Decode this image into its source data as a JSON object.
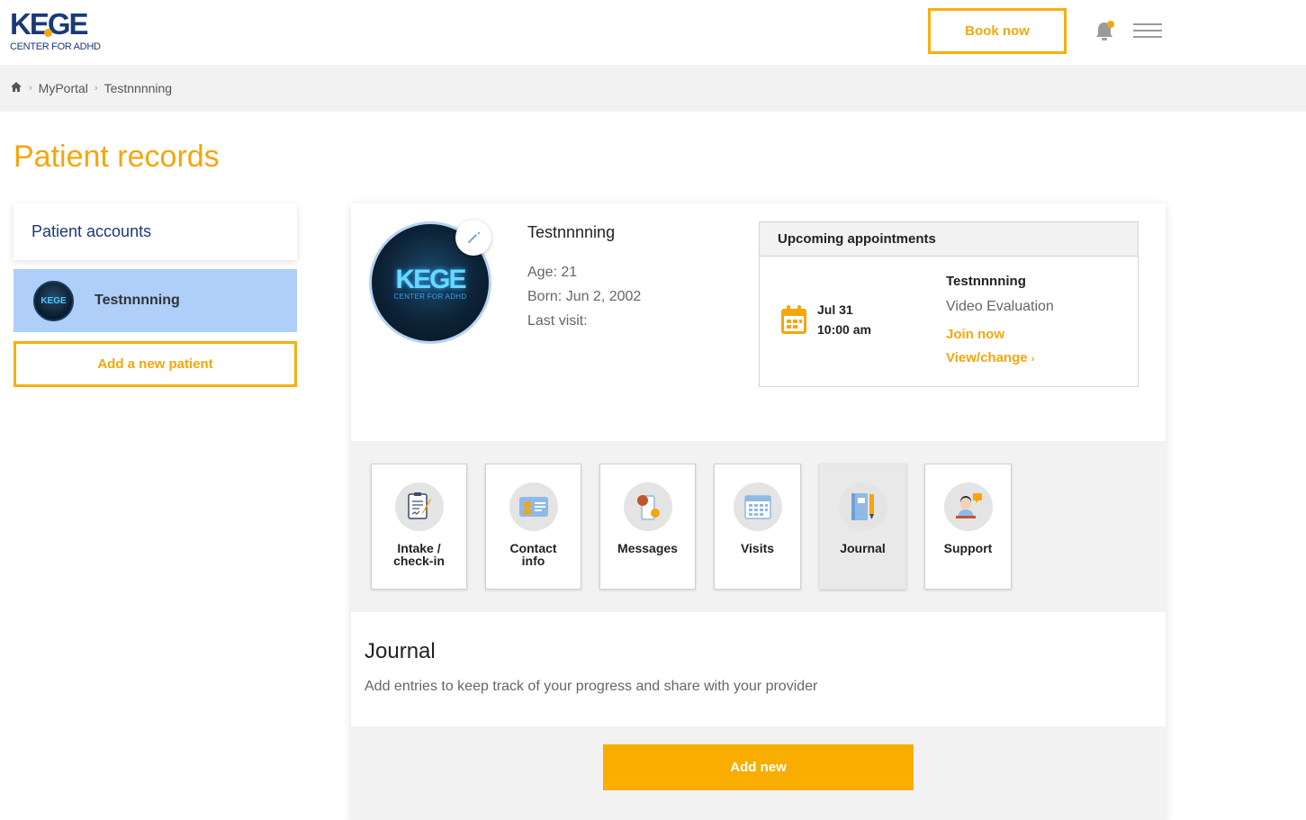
{
  "brand": {
    "logo_text": "KEGE",
    "logo_sub": "CENTER FOR ADHD",
    "accent": "#f5a60b",
    "navy": "#1a3a78"
  },
  "header": {
    "book_label": "Book now",
    "bell_icon": "bell-icon",
    "menu_icon": "hamburger-icon"
  },
  "breadcrumb": {
    "home_icon": "home-icon",
    "items": [
      "MyPortal",
      "Testnnnning"
    ]
  },
  "page": {
    "title": "Patient records"
  },
  "sidebar": {
    "heading": "Patient accounts",
    "patients": [
      {
        "name": "Testnnnning",
        "avatar_text": "KEGE"
      }
    ],
    "add_label": "Add a new patient"
  },
  "patient": {
    "avatar_text": "KEGE",
    "avatar_sub": "CENTER FOR ADHD",
    "name": "Testnnnning",
    "age": "Age: 21",
    "born": "Born: Jun 2, 2002",
    "last_visit": "Last visit:"
  },
  "appointments": {
    "heading": "Upcoming appointments",
    "items": [
      {
        "date": "Jul 31",
        "time": "10:00 am",
        "name": "Testnnnning",
        "type": "Video Evaluation",
        "join_label": "Join now",
        "view_label": "View/change",
        "view_chevron": "›"
      }
    ]
  },
  "tiles": [
    {
      "label": "Intake /\ncheck-in",
      "icon": "clipboard-pen-icon",
      "active": false
    },
    {
      "label": "Contact\ninfo",
      "icon": "id-card-icon",
      "active": false
    },
    {
      "label": "Messages",
      "icon": "phone-chat-icon",
      "active": false
    },
    {
      "label": "Visits",
      "icon": "calendar-grid-icon",
      "active": false
    },
    {
      "label": "Journal",
      "icon": "notebook-pencil-icon",
      "active": true
    },
    {
      "label": "Support",
      "icon": "agent-chat-icon",
      "active": false
    }
  ],
  "journal": {
    "title": "Journal",
    "description": "Add entries to keep track of your progress and share with your provider",
    "add_label": "Add new"
  }
}
